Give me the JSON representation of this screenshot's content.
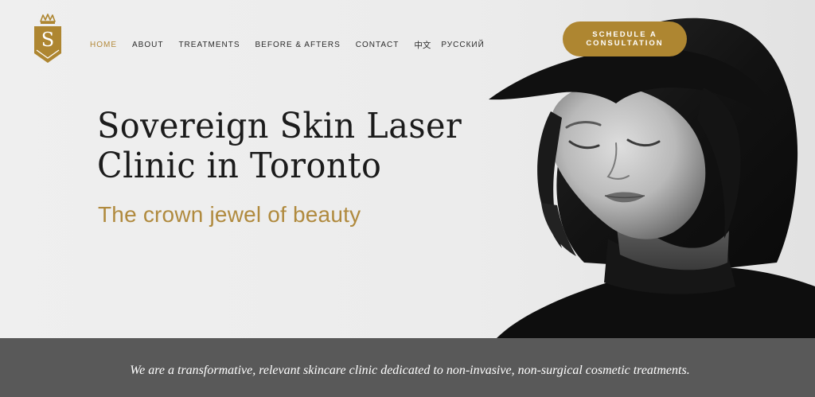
{
  "brand": {
    "logo_letter": "S",
    "logo_icon": "crown-shield-icon",
    "gold": "#ae8631"
  },
  "nav": {
    "items": [
      {
        "label": "HOME",
        "active": true
      },
      {
        "label": "ABOUT"
      },
      {
        "label": "TREATMENTS"
      },
      {
        "label": "BEFORE & AFTERS"
      },
      {
        "label": "CONTACT"
      },
      {
        "label": "中文"
      },
      {
        "label": "РУССКИЙ"
      }
    ]
  },
  "cta": {
    "label": "SCHEDULE A CONSULTATION"
  },
  "hero": {
    "title_line1": "Sovereign Skin Laser",
    "title_line2": "Clinic in Toronto",
    "tagline": "The crown jewel of beauty",
    "image": "black-and-white-portrait-woman-with-bob-haircut"
  },
  "band": {
    "text": "We are a transformative, relevant skincare clinic dedicated to non-invasive, non-surgical cosmetic treatments.",
    "background": "#595959"
  }
}
